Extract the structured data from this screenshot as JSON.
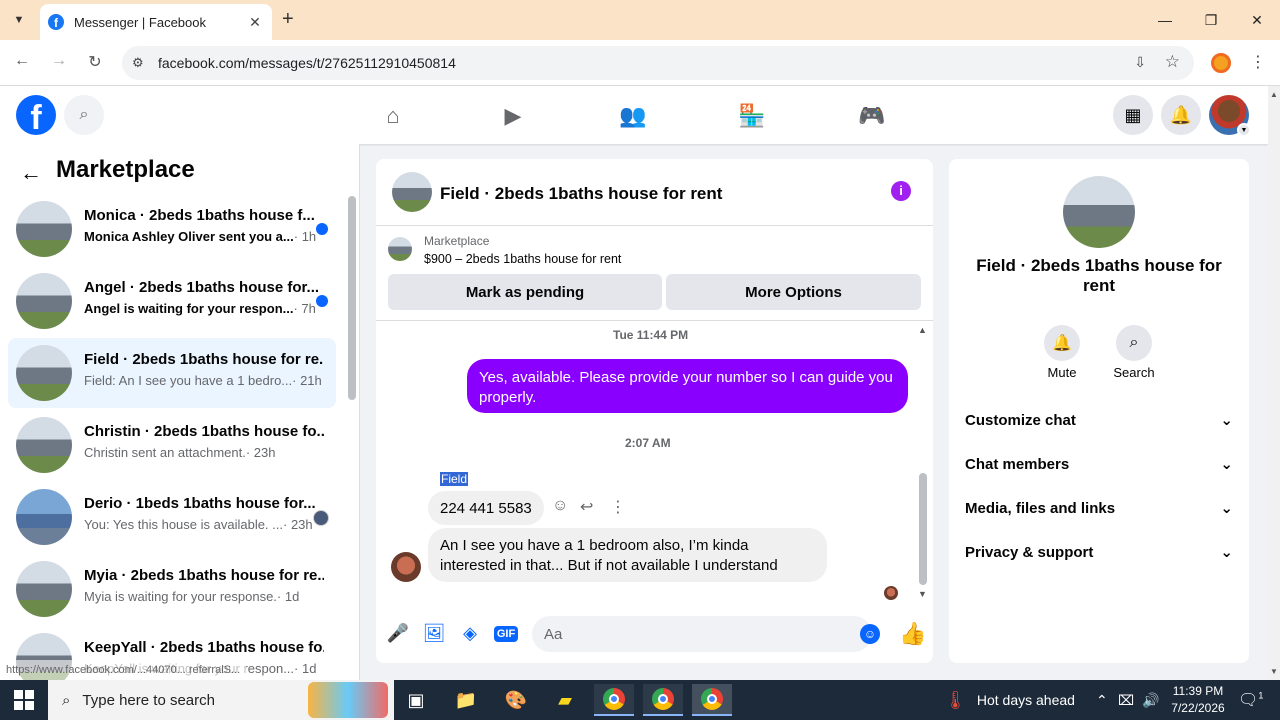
{
  "browser": {
    "tab_title": "Messenger | Facebook",
    "url": "facebook.com/messages/t/27625112910450814",
    "status_url": "https://www.facebook.com/...44070... referralS..."
  },
  "sidebar": {
    "title": "Marketplace",
    "conversations": [
      {
        "name": "Monica · 2beds 1baths house f...",
        "preview": "Monica Ashley Oliver sent you a...",
        "time": "· 1h",
        "unread": true
      },
      {
        "name": "Angel · 2beds 1baths house for...",
        "preview": "Angel is waiting for your respon...",
        "time": "· 7h",
        "unread": true
      },
      {
        "name": "Field · 2beds 1baths house for re...",
        "preview": "Field: An I see you have a 1 bedro...",
        "time": "· 21h",
        "selected": true
      },
      {
        "name": "Christin · 2beds 1baths house fo...",
        "preview": "Christin sent an attachment.",
        "time": "· 23h"
      },
      {
        "name": "Derio · 1beds 1baths house for...",
        "preview": "You: Yes this house is available. ...",
        "time": "· 23h",
        "seen": true
      },
      {
        "name": "Myia · 2beds 1baths house for re...",
        "preview": "Myia is waiting for your response.",
        "time": "· 1d"
      },
      {
        "name": "KeepYall · 2beds 1baths house fo...",
        "preview": "KeepYall is waiting for your respon...",
        "time": "· 1d"
      }
    ]
  },
  "chat": {
    "title": "Field · 2beds 1baths house for rent",
    "marketplace_label": "Marketplace",
    "listing": "$900 – 2beds 1baths house for rent",
    "btn_pending": "Mark as pending",
    "btn_more": "More Options",
    "ts1": "Tue 11:44 PM",
    "outgoing": "Yes, available. Please provide your number so I can guide you properly.",
    "ts2": "2:07 AM",
    "sender": "Field",
    "msg_phone": "224 441 5583",
    "msg_text": "An I see you have a 1 bedroom also, I’m kinda interested in that... But if not available I understand",
    "composer_placeholder": "Aa"
  },
  "details": {
    "title": "Field · 2beds 1baths house for rent",
    "mute_label": "Mute",
    "search_label": "Search",
    "sections": [
      "Customize chat",
      "Chat members",
      "Media, files and links",
      "Privacy & support"
    ]
  },
  "taskbar": {
    "search_placeholder": "Type here to search",
    "weather": "Hot days ahead",
    "time": "11:39 PM",
    "date": "7/22/2026",
    "notif_count": "1"
  },
  "icons": {
    "accent": "#0866ff",
    "outgoing_bubble": "#8a00ff"
  }
}
